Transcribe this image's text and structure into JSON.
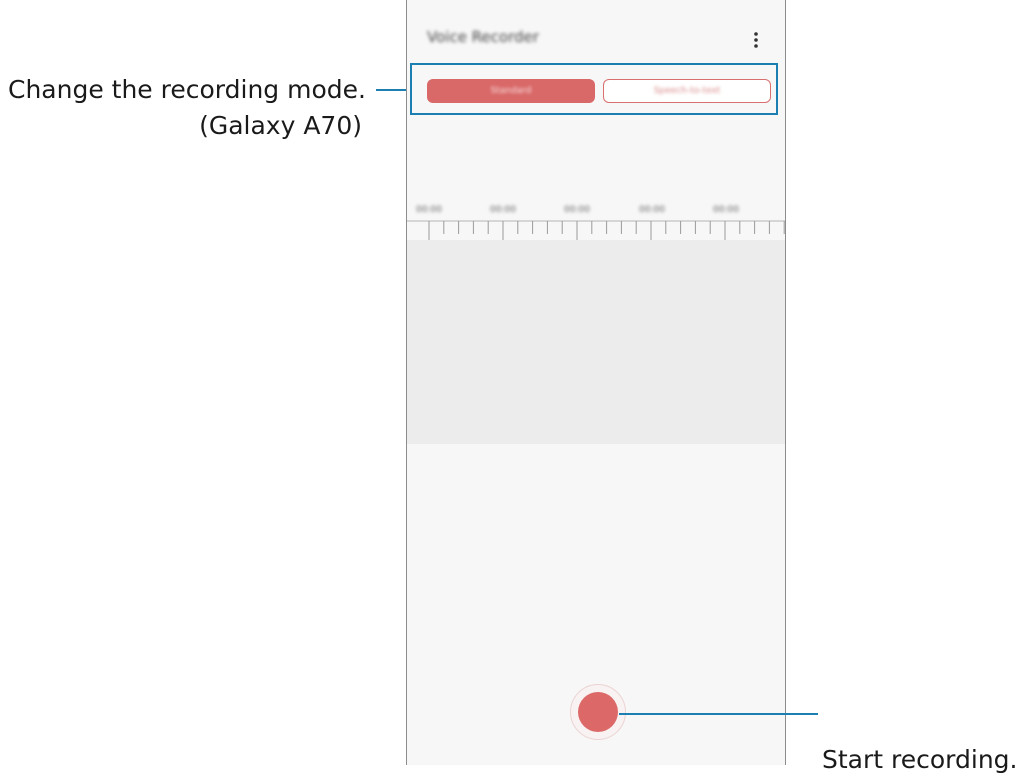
{
  "app": {
    "title": "Voice Recorder",
    "more_icon": "more-vertical-icon"
  },
  "mode_tabs": [
    {
      "label": "Standard",
      "selected": true
    },
    {
      "label": "Speech-to-text",
      "selected": false
    }
  ],
  "timeline": {
    "labels": [
      "00:00",
      "00:00",
      "00:00",
      "00:00",
      "00:00"
    ]
  },
  "record_button": {
    "icon": "record-icon",
    "color": "#dc6868"
  },
  "callouts": {
    "mode": {
      "line1": "Change the recording mode.",
      "line2": "(Galaxy A70)"
    },
    "record": {
      "text": "Start recording."
    }
  },
  "colors": {
    "accent_line": "#1b7fb1",
    "record_red": "#dc6868",
    "screen_bg": "#f6f7f6",
    "wave_bg": "#ececec"
  }
}
